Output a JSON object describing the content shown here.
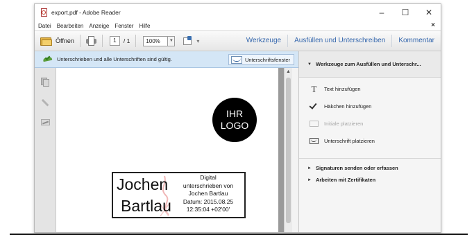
{
  "window": {
    "title": "export.pdf - Adobe Reader",
    "controls": {
      "minimize": "–",
      "maximize": "☐",
      "close": "✕"
    }
  },
  "menubar": {
    "items": [
      "Datei",
      "Bearbeiten",
      "Anzeige",
      "Fenster",
      "Hilfe"
    ],
    "close": "×"
  },
  "toolbar": {
    "open_label": "Öffnen",
    "page_current": "1",
    "page_total": "/ 1",
    "zoom": "100%",
    "zoom_dropdown": "▼",
    "more": "▾",
    "links": [
      "Werkzeuge",
      "Ausfüllen und Unterschreiben",
      "Kommentar"
    ]
  },
  "signature_bar": {
    "status": "Unterschrieben und alle Unterschriften sind gültig.",
    "window_button": "Unterschriftsfenster"
  },
  "document": {
    "logo_line1": "IHR",
    "logo_line2": "LOGO",
    "signature": {
      "first_name": "Jochen",
      "last_name": "Bartlau",
      "details": [
        "Digital",
        "unterschrieben von",
        "Jochen Bartlau",
        "Datum: 2015.08.25",
        "12:35:04 +02'00'"
      ]
    },
    "scroll_up": "▲"
  },
  "tools_panel": {
    "header_caret": "▼",
    "header": "Werkzeuge zum Ausfüllen und Unterschr...",
    "items": [
      {
        "label": "Text hinzufügen",
        "icon": "text-icon",
        "glyph": "T",
        "enabled": true
      },
      {
        "label": "Häkchen hinzufügen",
        "icon": "checkmark-icon",
        "enabled": true
      },
      {
        "label": "Initiale platzieren",
        "icon": "initials-icon",
        "enabled": false
      },
      {
        "label": "Unterschrift platzieren",
        "icon": "place-signature-icon",
        "enabled": true
      }
    ],
    "sections": [
      {
        "caret": "►",
        "label": "Signaturen senden oder erfassen"
      },
      {
        "caret": "►",
        "label": "Arbeiten mit Zertifikaten"
      }
    ]
  },
  "colors": {
    "link_blue": "#3567ad",
    "sigbar_bg": "#d4e6f6",
    "valid_green": "#5b9d3c"
  }
}
